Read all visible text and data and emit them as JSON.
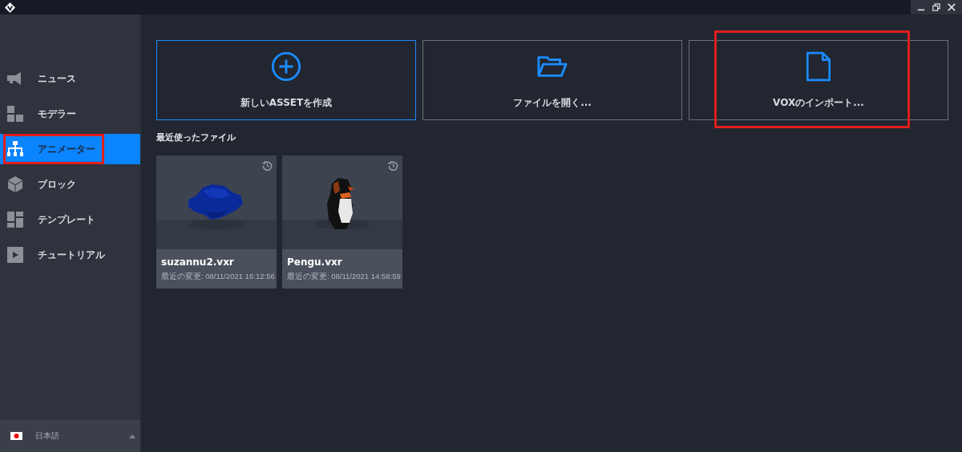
{
  "window": {
    "controls": [
      {
        "kind": "minimize"
      },
      {
        "kind": "restore"
      },
      {
        "kind": "close"
      }
    ]
  },
  "sidebar": {
    "items": [
      {
        "label": "ニュース",
        "selected": false,
        "highlighted": false
      },
      {
        "label": "モデラー",
        "selected": false,
        "highlighted": false
      },
      {
        "label": "アニメーター",
        "selected": true,
        "highlighted": true
      },
      {
        "label": "ブロック",
        "selected": false,
        "highlighted": false
      },
      {
        "label": "テンプレート",
        "selected": false,
        "highlighted": false
      },
      {
        "label": "チュートリアル",
        "selected": false,
        "highlighted": false
      }
    ],
    "language": {
      "label": "日本語",
      "expanded": false
    }
  },
  "actions": [
    {
      "label": "新しいASSETを作成",
      "selected": true,
      "highlighted": false
    },
    {
      "label": "ファイルを開く...",
      "selected": false,
      "highlighted": false
    },
    {
      "label": "VOXのインポート...",
      "selected": false,
      "highlighted": true
    }
  ],
  "recent": {
    "heading": "最近使ったファイル",
    "files": [
      {
        "name": "suzannu2.vxr",
        "modified": "最近の変更: 08/11/2021 16:12:56"
      },
      {
        "name": "Pengu.vxr",
        "modified": "最近の変更: 08/11/2021 14:58:59"
      }
    ]
  }
}
